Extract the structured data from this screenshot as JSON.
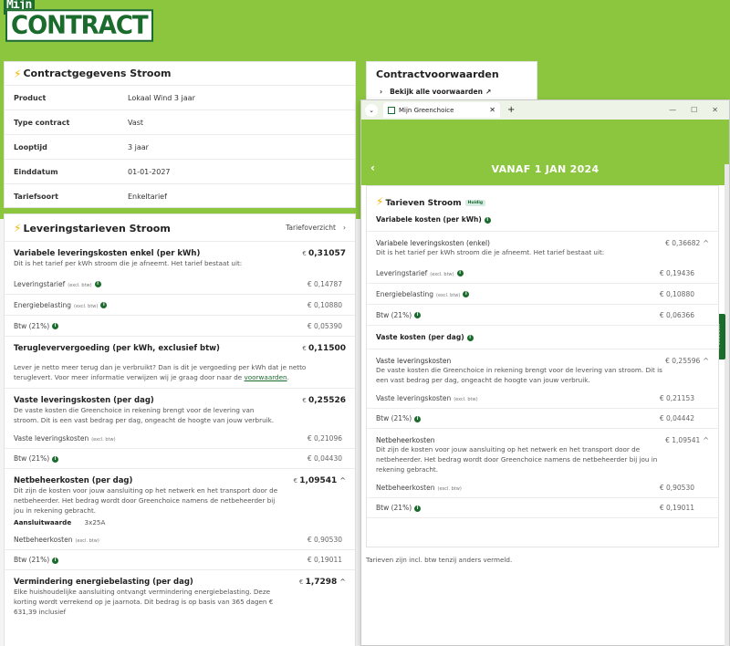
{
  "logo": {
    "top": "Mijn",
    "main": "CONTRACT"
  },
  "contract": {
    "title": "Contractgegevens Stroom",
    "rows": [
      {
        "k": "Product",
        "v": "Lokaal Wind 3 jaar"
      },
      {
        "k": "Type contract",
        "v": "Vast"
      },
      {
        "k": "Looptijd",
        "v": "3 jaar"
      },
      {
        "k": "Einddatum",
        "v": "01-01-2027"
      },
      {
        "k": "Tariefsoort",
        "v": "Enkeltarief"
      }
    ]
  },
  "voorwaarden": {
    "title": "Contractvoorwaarden",
    "link": "Bekijk alle voorwaarden"
  },
  "tarieven": {
    "title": "Leveringstarieven Stroom",
    "overview_link": "Tariefoverzicht",
    "var_title": "Variabele leveringskosten enkel (per kWh)",
    "var_value": "0,31057",
    "var_desc": "Dit is het tarief per kWh stroom die je afneemt. Het tarief bestaat uit:",
    "var_rows": [
      {
        "label": "Leveringstarief",
        "note": "(excl. btw)",
        "value": "€ 0,14787"
      },
      {
        "label": "Energiebelasting",
        "note": "(excl. btw)",
        "value": "€ 0,10880"
      },
      {
        "label": "Btw (21%)",
        "note": "",
        "value": "€ 0,05390"
      }
    ],
    "teruglever_title": "Terugleververgoeding (per kWh, exclusief btw)",
    "teruglever_value": "0,11500",
    "teruglever_desc": "Lever je netto meer terug dan je verbruikt? Dan is dit je vergoeding per kWh dat je netto teruglevert. Voor meer informatie verwijzen wij je graag door naar de",
    "teruglever_link": "voorwaarden",
    "vast_title": "Vaste leveringskosten (per dag)",
    "vast_value": "0,25526",
    "vast_desc": "De vaste kosten die Greenchoice in rekening brengt voor de levering van stroom. Dit is een vast bedrag per dag, ongeacht de hoogte van jouw verbruik.",
    "vast_rows": [
      {
        "label": "Vaste leveringskosten",
        "note": "(excl. btw)",
        "value": "€ 0,21096"
      },
      {
        "label": "Btw (21%)",
        "note": "",
        "value": "€ 0,04430"
      }
    ],
    "net_title": "Netbeheerkosten (per dag)",
    "net_value": "1,09541",
    "net_desc": "Dit zijn de kosten voor jouw aansluiting op het netwerk en het transport door de netbeheerder. Het bedrag wordt door Greenchoice namens de netbeheerder bij jou in rekening gebracht.",
    "aansluit_label": "Aansluitwaarde",
    "aansluit_value": "3x25A",
    "net_rows": [
      {
        "label": "Netbeheerkosten",
        "note": "(excl. btw)",
        "value": "€ 0,90530"
      },
      {
        "label": "Btw (21%)",
        "note": "",
        "value": "€ 0,19011"
      }
    ],
    "verm_title": "Vermindering energiebelasting (per dag)",
    "verm_value": "1,7298",
    "verm_desc": "Elke huishoudelijke aansluiting ontvangt vermindering energiebelasting. Deze korting wordt verrekend op je jaarnota. Dit bedrag is op basis van 365 dagen € 631,39 inclusief"
  },
  "browser": {
    "tab_title": "Mijn Greenchoice",
    "heading": "VANAF 1 JAN 2024",
    "card_title": "Tarieven Stroom",
    "badge": "Huidig",
    "var_header": "Variabele kosten (per kWh)",
    "var_title": "Variabele leveringskosten (enkel)",
    "var_value": "€ 0,36682",
    "var_desc": "Dit is het tarief per kWh stroom die je afneemt. Het tarief bestaat uit:",
    "var_rows": [
      {
        "label": "Leveringstarief",
        "note": "(excl. btw)",
        "value": "€ 0,19436"
      },
      {
        "label": "Energiebelasting",
        "note": "(excl. btw)",
        "value": "€ 0,10880"
      },
      {
        "label": "Btw (21%)",
        "note": "",
        "value": "€ 0,06366"
      }
    ],
    "vast_header": "Vaste kosten (per dag)",
    "vast_title": "Vaste leveringskosten",
    "vast_value": "€ 0,25596",
    "vast_desc": "De vaste kosten die Greenchoice in rekening brengt voor de levering van stroom. Dit is een vast bedrag per dag, ongeacht de hoogte van jouw verbruik.",
    "vast_rows": [
      {
        "label": "Vaste leveringskosten",
        "note": "(excl. btw)",
        "value": "€ 0,21153"
      },
      {
        "label": "Btw (21%)",
        "note": "",
        "value": "€ 0,04442"
      }
    ],
    "net_title": "Netbeheerkosten",
    "net_value": "€ 1,09541",
    "net_desc": "Dit zijn de kosten voor jouw aansluiting op het netwerk en het transport door de netbeheerder. Het bedrag wordt door Greenchoice namens de netbeheerder bij jou in rekening gebracht.",
    "net_rows": [
      {
        "label": "Netbeheerkosten",
        "note": "(excl. btw)",
        "value": "€ 0,90530"
      },
      {
        "label": "Btw (21%)",
        "note": "",
        "value": "€ 0,19011"
      }
    ],
    "footer": "Tarieven zijn incl. btw tenzij anders vermeld.",
    "feedback": "Feedback"
  }
}
